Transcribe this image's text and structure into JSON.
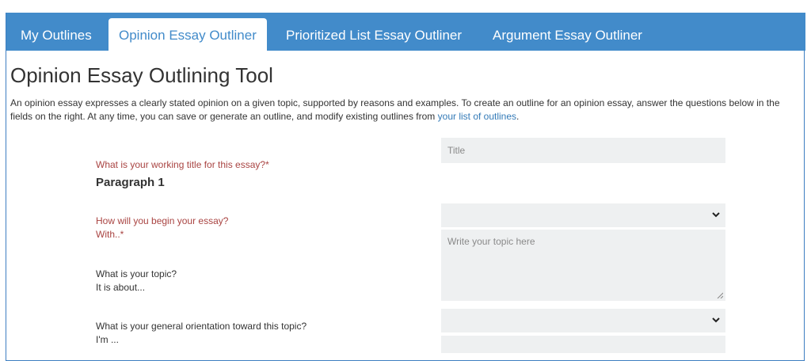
{
  "tabs": [
    {
      "label": "My Outlines",
      "active": false
    },
    {
      "label": "Opinion Essay Outliner",
      "active": true
    },
    {
      "label": "Prioritized List Essay Outliner",
      "active": false
    },
    {
      "label": "Argument Essay Outliner",
      "active": false
    }
  ],
  "page": {
    "title": "Opinion Essay Outlining Tool",
    "intro_text": "An opinion essay expresses a clearly stated opinion on a given topic, supported by reasons and examples. To create an outline for an opinion essay, answer the questions below in the fields on the right. At any time, you can save or generate an outline, and modify existing outlines from ",
    "intro_link": "your list of outlines",
    "intro_end": "."
  },
  "form": {
    "title_question": "What is your working title for this essay?*",
    "title_placeholder": "Title",
    "paragraph_heading": "Paragraph 1",
    "begin_question_line1": "How will you begin your essay?",
    "begin_question_line2": "With..*",
    "begin_value": "",
    "topic_question_line1": "What is your topic?",
    "topic_question_line2": "It is about...",
    "topic_placeholder": "Write your topic here",
    "orientation_question_line1": "What is your general orientation toward this topic?",
    "orientation_question_line2": "I'm ...",
    "orientation_value": ""
  },
  "colors": {
    "tabbar": "#428bca",
    "required_label": "#a94442",
    "link": "#337ab7",
    "field_bg": "#eef0f1"
  }
}
